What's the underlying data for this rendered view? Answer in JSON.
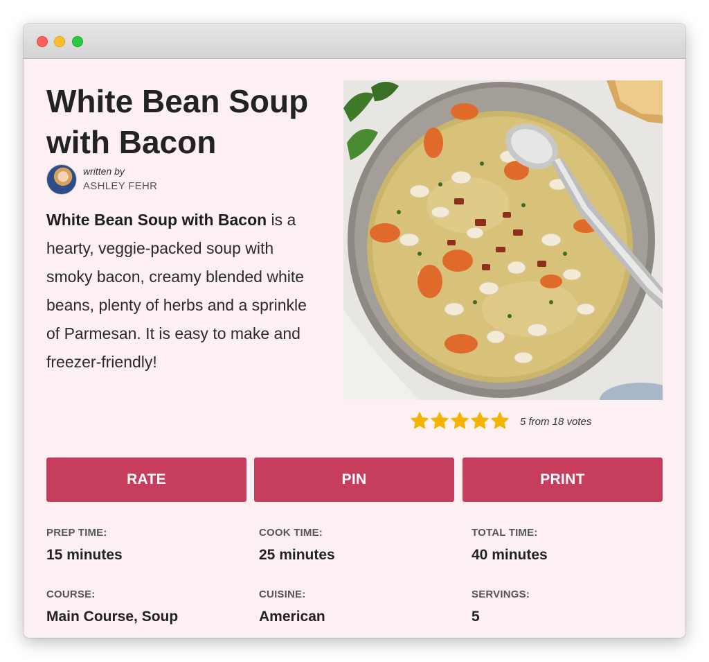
{
  "window": {
    "controls": [
      "close",
      "minimize",
      "maximize"
    ],
    "colors": {
      "close": "#fe5f57",
      "minimize": "#febc2e",
      "maximize": "#28c840"
    }
  },
  "recipe": {
    "title": "White Bean Soup with Bacon",
    "author_prefix": "written by",
    "author_name": "ASHLEY FEHR",
    "description_bold": "White Bean Soup with Bacon",
    "description_rest": " is a hearty, veggie-packed soup with smoky bacon, creamy blended white beans, plenty of herbs and a sprinkle of Parmesan. It is easy to make and freezer-friendly!",
    "image_icon": "soup-bowl-photo"
  },
  "rating": {
    "stars_filled": 5,
    "stars_total": 5,
    "text": "5 from 18 votes",
    "star_color": "#f5b301"
  },
  "buttons": {
    "rate": "RATE",
    "pin": "PIN",
    "print": "PRINT",
    "color": "#c73d5e"
  },
  "meta": [
    {
      "label": "PREP TIME:",
      "value": "15 minutes"
    },
    {
      "label": "COOK TIME:",
      "value": "25 minutes"
    },
    {
      "label": "TOTAL TIME:",
      "value": "40 minutes"
    },
    {
      "label": "COURSE:",
      "value": "Main Course, Soup"
    },
    {
      "label": "CUISINE:",
      "value": "American"
    },
    {
      "label": "SERVINGS:",
      "value": "5"
    }
  ]
}
